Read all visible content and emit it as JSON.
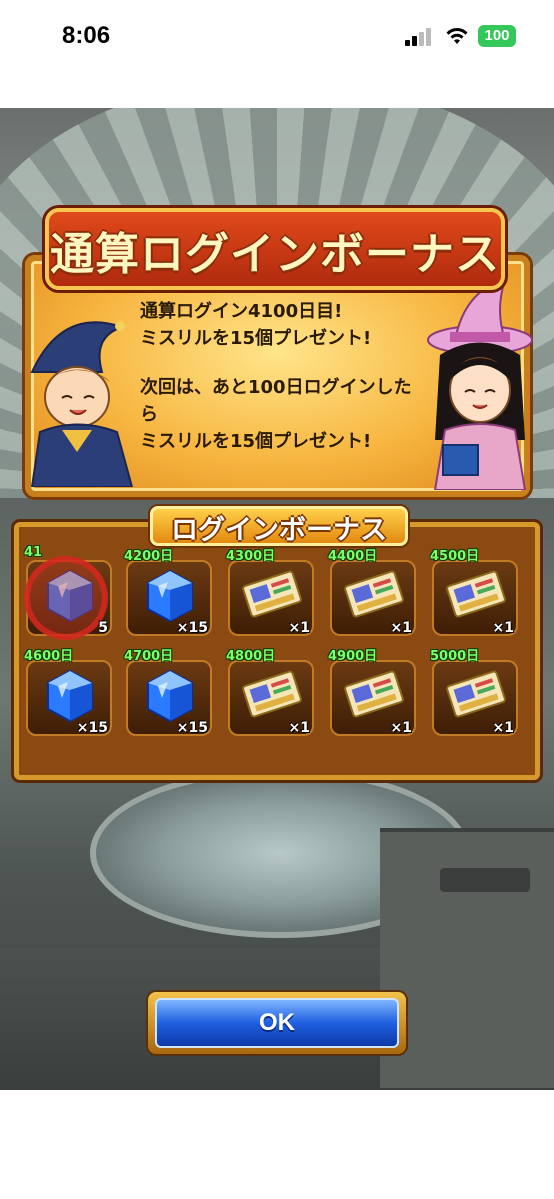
{
  "status_bar": {
    "time": "8:06",
    "battery": "100",
    "battery_color": "#34c759"
  },
  "banner": {
    "title": "通算ログインボーナス",
    "line1": "通算ログイン4100日目!",
    "line2": "ミスリルを15個プレゼント!",
    "line3": "次回は、あと100日ログインした",
    "line4": "ら",
    "line5": "ミスリルを15個プレゼント!"
  },
  "board": {
    "title": "ログインボーナス",
    "rewards": [
      {
        "day": "41",
        "item": "mithril-gem-icon",
        "qty": "5",
        "claimed": true
      },
      {
        "day": "4200日",
        "item": "mithril-gem-icon",
        "qty": "×15",
        "claimed": false
      },
      {
        "day": "4300日",
        "item": "ticket-icon",
        "qty": "×1",
        "claimed": false
      },
      {
        "day": "4400日",
        "item": "ticket-icon",
        "qty": "×1",
        "claimed": false
      },
      {
        "day": "4500日",
        "item": "ticket-icon",
        "qty": "×1",
        "claimed": false
      },
      {
        "day": "4600日",
        "item": "mithril-gem-icon",
        "qty": "×15",
        "claimed": false
      },
      {
        "day": "4700日",
        "item": "mithril-gem-icon",
        "qty": "×15",
        "claimed": false
      },
      {
        "day": "4800日",
        "item": "ticket-icon",
        "qty": "×1",
        "claimed": false
      },
      {
        "day": "4900日",
        "item": "ticket-icon",
        "qty": "×1",
        "claimed": false
      },
      {
        "day": "5000日",
        "item": "ticket-icon",
        "qty": "×1",
        "claimed": false
      }
    ]
  },
  "ok_button": {
    "label": "OK"
  },
  "colors": {
    "day_label": "#7dff6a",
    "banner_frame": "#c7801c",
    "title_plate": "#e04a1a",
    "ok_blue": "#1e5fe0"
  }
}
